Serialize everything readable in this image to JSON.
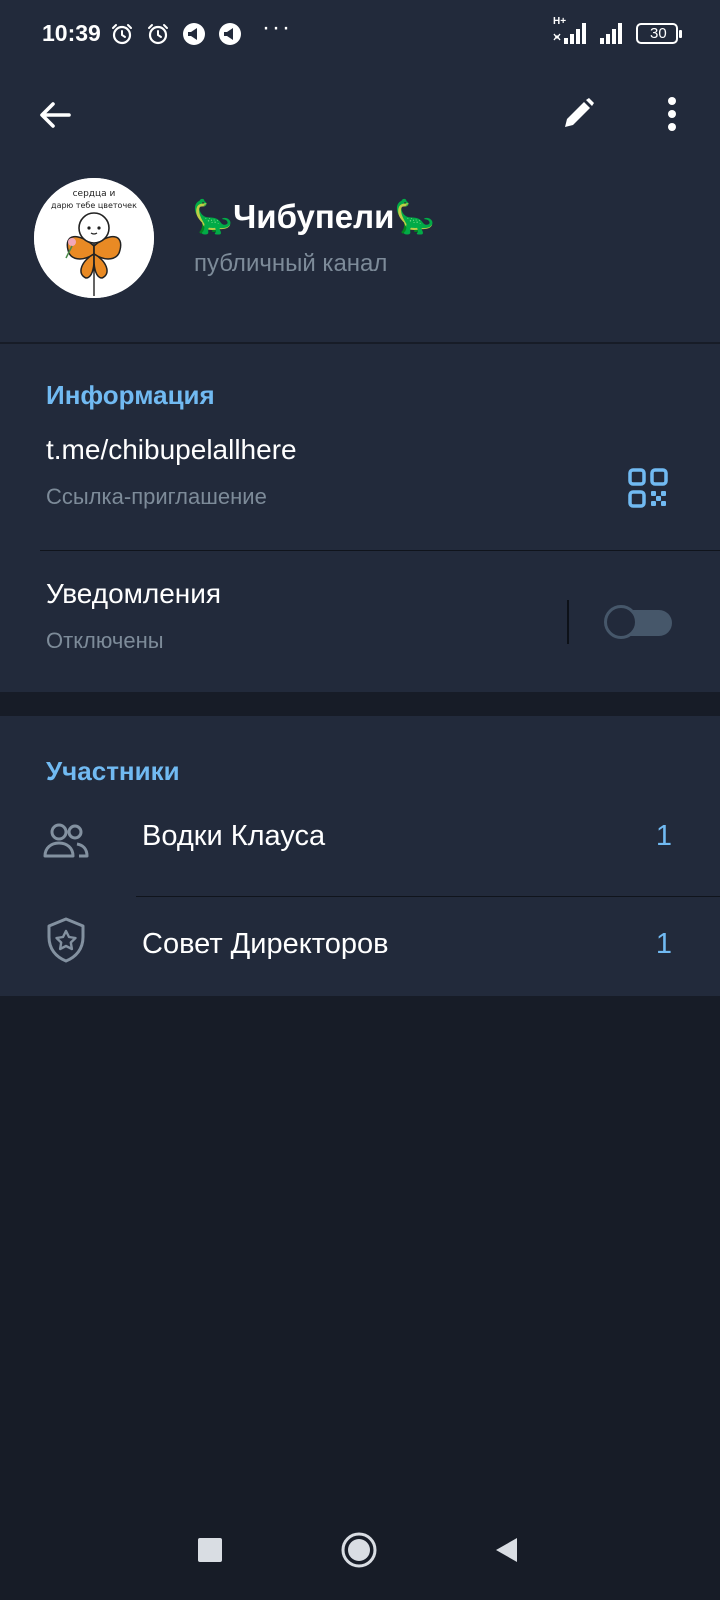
{
  "status_bar": {
    "time": "10:39",
    "network_type": "H+",
    "battery_level": "30",
    "overflow_indicator": "···"
  },
  "header": {
    "channel_name": "🦕Чибупели🦕",
    "channel_type": "публичный канал",
    "avatar_caption_line1": "сердца и",
    "avatar_caption_line2": "дарю тебе цветочек"
  },
  "info": {
    "section_title": "Информация",
    "link": "t.me/chibupelallhere",
    "link_label": "Ссылка-приглашение",
    "notifications_title": "Уведомления",
    "notifications_state": "Отключены",
    "notifications_enabled": false
  },
  "members": {
    "section_title": "Участники",
    "items": [
      {
        "label": "Водки Клауса",
        "count": "1",
        "icon": "people-icon"
      },
      {
        "label": "Совет Директоров",
        "count": "1",
        "icon": "shield-star-icon"
      }
    ]
  },
  "colors": {
    "background": "#171c27",
    "surface": "#222a3b",
    "accent": "#71baf2",
    "secondary_text": "#7d8b99"
  }
}
